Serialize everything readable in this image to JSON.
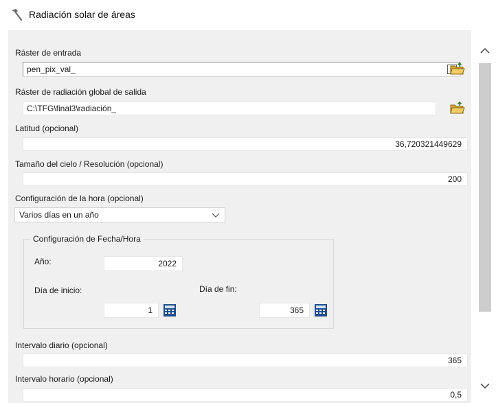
{
  "window": {
    "title": "Radiación solar de áreas",
    "title_icon": "hammer-icon"
  },
  "input_raster": {
    "label": "Ráster de entrada",
    "value": "pen_pix_val_"
  },
  "output_raster": {
    "label": "Ráster de radiación global de salida",
    "value": "C:\\TFG\\final3\\radiación_"
  },
  "latitude": {
    "label": "Latitud (opcional)",
    "value": "36,720321449629"
  },
  "sky_size": {
    "label": "Tamaño del cielo / Resolución (opcional)",
    "value": "200"
  },
  "time_config": {
    "label": "Configuración de la hora (opcional)",
    "selected": "Varios días en un año"
  },
  "datetime_group": {
    "title": "Configuración de Fecha/Hora",
    "year_label": "Año:",
    "year_value": "2022",
    "start_label": "Día de inicio:",
    "start_value": "1",
    "end_label": "Día de fin:",
    "end_value": "365"
  },
  "day_interval": {
    "label": "Intervalo diario (opcional)",
    "value": "365"
  },
  "hour_interval": {
    "label": "Intervalo horario (opcional)",
    "value": "0,5"
  },
  "icons": {
    "browse": "folder-open-icon",
    "calendar": "calculator-icon",
    "scroll_up": "chevron-up-icon",
    "scroll_down": "chevron-down-icon"
  }
}
